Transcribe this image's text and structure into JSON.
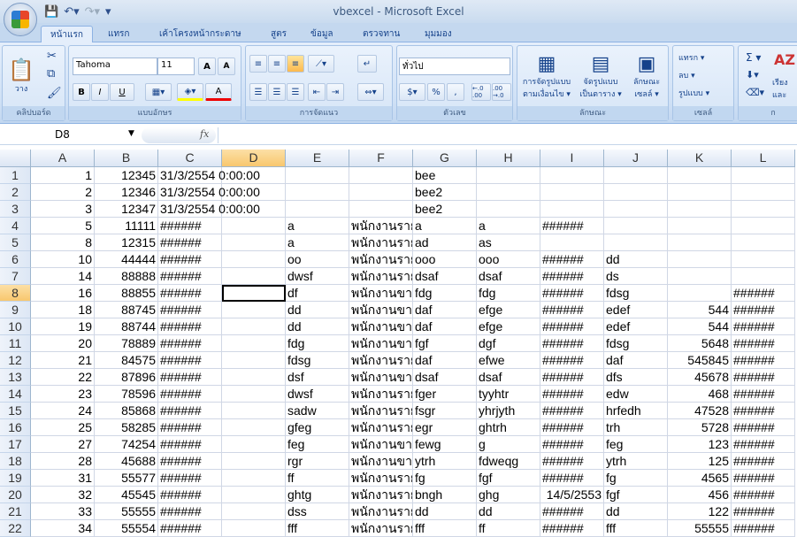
{
  "window": {
    "title": "vbexcel - Microsoft Excel"
  },
  "tabs": [
    "หน้าแรก",
    "แทรก",
    "เค้าโครงหน้ากระดาษ",
    "สูตร",
    "ข้อมูล",
    "ตรวจทาน",
    "มุมมอง"
  ],
  "ribbon": {
    "clipboard": {
      "label": "คลิปบอร์ด",
      "paste": "วาง"
    },
    "font": {
      "label": "แบบอักษร",
      "name": "Tahoma",
      "size": "11",
      "bold": "B",
      "italic": "I",
      "underline": "U",
      "grow": "A",
      "shrink": "A",
      "color": "A"
    },
    "alignment": {
      "label": "การจัดแนว"
    },
    "number": {
      "label": "ตัวเลข",
      "format": "ทั่วไป",
      "percent": "%",
      "comma": ",",
      "inc": "←.0 .00",
      "dec": ".00 →.0"
    },
    "styles": {
      "label": "ลักษณะ",
      "conditional": "การจัดรูปแบบ ตามเงื่อนไข ▾",
      "table": "จัดรูปแบบ เป็นตาราง ▾",
      "cell": "ลักษณะ เซลล์ ▾"
    },
    "cells": {
      "label": "เซลล์",
      "insert": "แทรก ▾",
      "delete": "ลบ ▾",
      "format": "รูปแบบ ▾"
    },
    "editing": {
      "label": "ก",
      "sum": "Σ ▾",
      "sort": "เรียง และ"
    }
  },
  "formula_bar": {
    "name_box": "D8",
    "fx": "fx",
    "value": ""
  },
  "sheet": {
    "columns": [
      "A",
      "B",
      "C",
      "D",
      "E",
      "F",
      "G",
      "H",
      "I",
      "J",
      "K",
      "L"
    ],
    "active_cell": "D8",
    "rows": [
      [
        "1",
        "12345",
        "31/3/2554 0:00:00",
        "",
        "",
        "",
        "bee",
        "",
        "",
        "",
        "",
        ""
      ],
      [
        "2",
        "12346",
        "31/3/2554 0:00:00",
        "",
        "",
        "",
        "bee2",
        "",
        "",
        "",
        "",
        ""
      ],
      [
        "3",
        "12347",
        "31/3/2554 0:00:00",
        "",
        "",
        "",
        "bee2",
        "",
        "",
        "",
        "",
        ""
      ],
      [
        "5",
        "11111",
        "######",
        "",
        "a",
        "พนักงานราย",
        "a",
        "a",
        "######",
        "",
        "",
        ""
      ],
      [
        "8",
        "12315",
        "######",
        "",
        "a",
        "พนักงานราย",
        "ad",
        "as",
        "",
        "",
        "",
        ""
      ],
      [
        "10",
        "44444",
        "######",
        "",
        "oo",
        "พนักงานราย",
        "ooo",
        "ooo",
        "######",
        "dd",
        "",
        ""
      ],
      [
        "14",
        "88888",
        "######",
        "",
        "dwsf",
        "พนักงานราย",
        "dsaf",
        "dsaf",
        "######",
        "ds",
        "",
        ""
      ],
      [
        "16",
        "88855",
        "######",
        "",
        "df",
        "พนักงานขาย",
        "fdg",
        "fdg",
        "######",
        "fdsg",
        "",
        "######"
      ],
      [
        "18",
        "88745",
        "######",
        "",
        "dd",
        "พนักงานขาย",
        "daf",
        "efge",
        "######",
        "edef",
        "544",
        "######"
      ],
      [
        "19",
        "88744",
        "######",
        "",
        "dd",
        "พนักงานขาย",
        "daf",
        "efge",
        "######",
        "edef",
        "544",
        "######"
      ],
      [
        "20",
        "78889",
        "######",
        "",
        "fdg",
        "พนักงานขาย",
        "fgf",
        "dgf",
        "######",
        "fdsg",
        "5648",
        "######"
      ],
      [
        "21",
        "84575",
        "######",
        "",
        "fdsg",
        "พนักงานราย",
        "daf",
        "efwe",
        "######",
        "daf",
        "545845",
        "######"
      ],
      [
        "22",
        "87896",
        "######",
        "",
        "dsf",
        "พนักงานขาย",
        "dsaf",
        "dsaf",
        "######",
        "dfs",
        "45678",
        "######"
      ],
      [
        "23",
        "78596",
        "######",
        "",
        "dwsf",
        "พนักงานราย",
        "fger",
        "tyyhtr",
        "######",
        "edw",
        "468",
        "######"
      ],
      [
        "24",
        "85868",
        "######",
        "",
        "sadw",
        "พนักงานราย",
        "fsgr",
        "yhrjyth",
        "######",
        "hrfedh",
        "47528",
        "######"
      ],
      [
        "25",
        "58285",
        "######",
        "",
        "gfeg",
        "พนักงานราย",
        "egr",
        "ghtrh",
        "######",
        "trh",
        "5728",
        "######"
      ],
      [
        "27",
        "74254",
        "######",
        "",
        "feg",
        "พนักงานขาย",
        "fewg",
        "g",
        "######",
        "feg",
        "123",
        "######"
      ],
      [
        "28",
        "45688",
        "######",
        "",
        "rgr",
        "พนักงานขาย",
        "ytrh",
        "fdweqg",
        "######",
        "ytrh",
        "125",
        "######"
      ],
      [
        "31",
        "55577",
        "######",
        "",
        "ff",
        "พนักงานราย",
        "fg",
        "fgf",
        "######",
        "fg",
        "4565",
        "######"
      ],
      [
        "32",
        "45545",
        "######",
        "",
        "ghtg",
        "พนักงานราย",
        "bngh",
        "ghg",
        "14/5/2553",
        "fgf",
        "456",
        "######"
      ],
      [
        "33",
        "55555",
        "######",
        "",
        "dss",
        "พนักงานราย",
        "dd",
        "dd",
        "######",
        "dd",
        "122",
        "######"
      ],
      [
        "34",
        "55554",
        "######",
        "",
        "fff",
        "พนักงานราย",
        "fff",
        "ff",
        "######",
        "fff",
        "55555",
        "######"
      ]
    ]
  }
}
